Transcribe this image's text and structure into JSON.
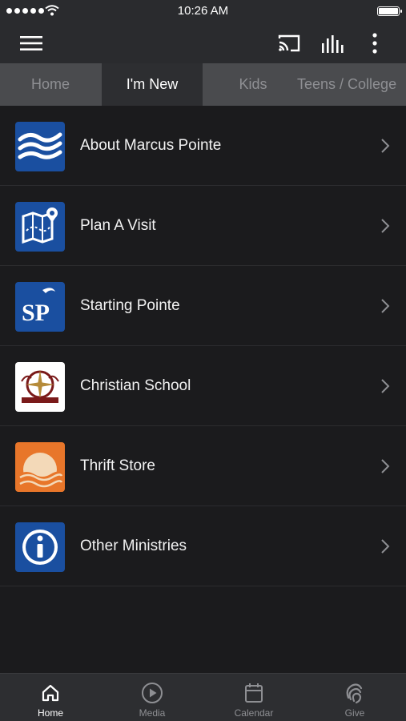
{
  "status_bar": {
    "time": "10:26 AM"
  },
  "tabs": [
    {
      "label": "Home",
      "active": false
    },
    {
      "label": "I'm New",
      "active": true
    },
    {
      "label": "Kids",
      "active": false
    },
    {
      "label": "Teens / College",
      "active": false
    }
  ],
  "list": [
    {
      "label": "About Marcus Pointe",
      "icon": "waves-logo-icon"
    },
    {
      "label": "Plan A Visit",
      "icon": "map-pin-icon"
    },
    {
      "label": "Starting Pointe",
      "icon": "sp-logo-icon"
    },
    {
      "label": "Christian School",
      "icon": "school-crest-icon"
    },
    {
      "label": "Thrift Store",
      "icon": "sunset-waves-icon"
    },
    {
      "label": "Other Ministries",
      "icon": "info-icon"
    }
  ],
  "bottom_nav": [
    {
      "label": "Home",
      "icon": "home-icon",
      "active": true
    },
    {
      "label": "Media",
      "icon": "play-circle-icon",
      "active": false
    },
    {
      "label": "Calendar",
      "icon": "calendar-icon",
      "active": false
    },
    {
      "label": "Give",
      "icon": "give-icon",
      "active": false
    }
  ],
  "colors": {
    "background": "#1b1b1d",
    "app_bar": "#2a2b2e",
    "tab_bar": "#4a4b4e",
    "tab_active": "#2d2e31",
    "icon_blue": "#1a4fa0",
    "icon_orange": "#e8762a"
  }
}
